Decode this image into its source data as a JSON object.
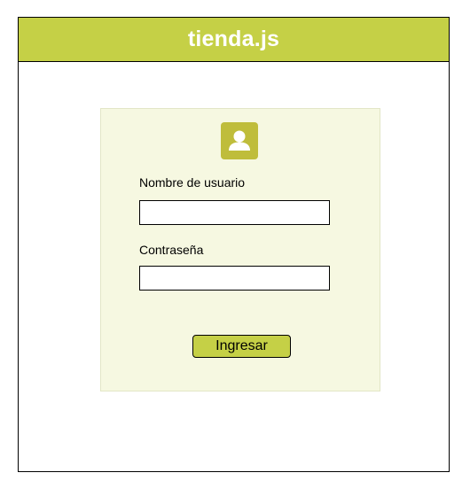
{
  "header": {
    "title": "tienda.js",
    "background": "#c5d046"
  },
  "login": {
    "icon": "user-icon",
    "username_label": "Nombre de usuario",
    "username_value": "",
    "password_label": "Contraseña",
    "password_value": "",
    "submit_label": "Ingresar"
  },
  "colors": {
    "accent": "#c5d046",
    "card_background": "#f6f8e1",
    "icon_background": "#bfbd3b"
  }
}
